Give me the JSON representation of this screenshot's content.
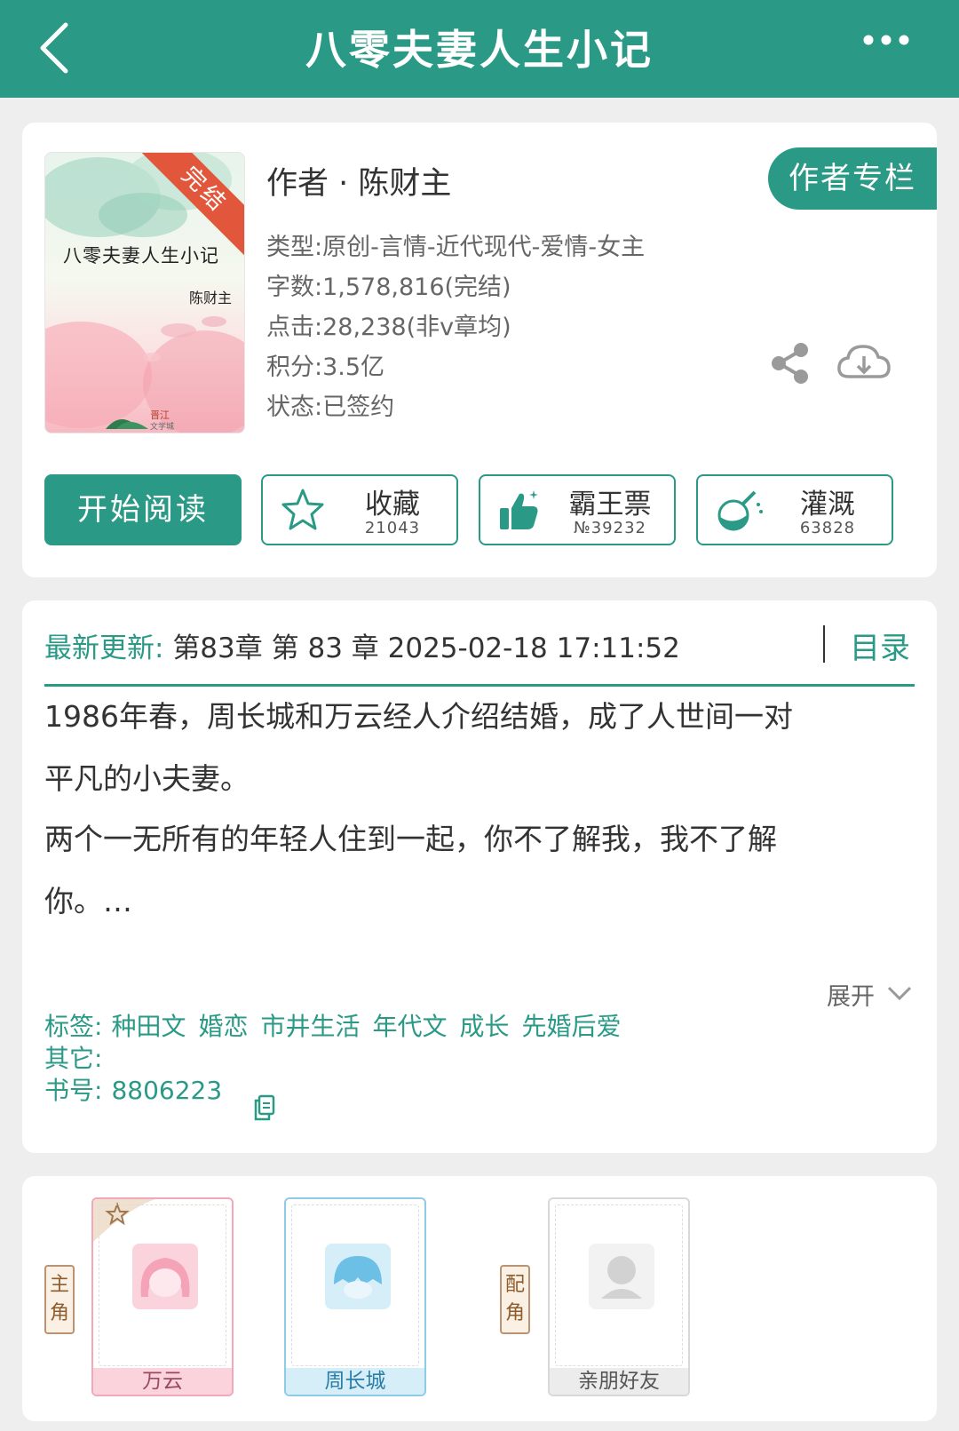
{
  "header": {
    "title": "八零夫妻人生小记"
  },
  "book": {
    "cover_title": "八零夫妻人生小记",
    "cover_author": "陈财主",
    "cover_badge": "完结",
    "author_line": "作者 · 陈财主",
    "author_column_button": "作者专栏",
    "meta": [
      "类型:原创-言情-近代现代-爱情-女主",
      "字数:1,578,816(完结)",
      "点击:28,238(非v章均)",
      "积分:3.5亿",
      "状态:已签约"
    ],
    "actions": {
      "read": "开始阅读",
      "favorite": {
        "label": "收藏",
        "count": "21043"
      },
      "vote": {
        "label": "霸王票",
        "count": "№39232"
      },
      "irrigate": {
        "label": "灌溉",
        "count": "63828"
      }
    }
  },
  "update": {
    "prefix": "最新更新:",
    "text": "第83章 第 83 章 2025-02-18 17:11:52",
    "catalog": "目录"
  },
  "intro": {
    "line1": "1986年春，周长城和万云经人介绍结婚，成了人世间一对",
    "line2": "平凡的小夫妻。",
    "line3": "两个一无所有的年轻人住到一起，你不了解我，我不了解",
    "line4": "你。…",
    "expand": "展开"
  },
  "tags": {
    "label": "标签:",
    "items": [
      "种田文",
      "婚恋",
      "市井生活",
      "年代文",
      "成长",
      "先婚后爱"
    ],
    "other_label": "其它:",
    "book_id_label": "书号:",
    "book_id": "8806223"
  },
  "characters": {
    "main_label": "主角",
    "support_label": "配角",
    "main": [
      "万云",
      "周长城"
    ],
    "support": [
      "亲朋好友"
    ]
  },
  "colors": {
    "brand": "#2a9a87",
    "badge": "#e2563b"
  }
}
